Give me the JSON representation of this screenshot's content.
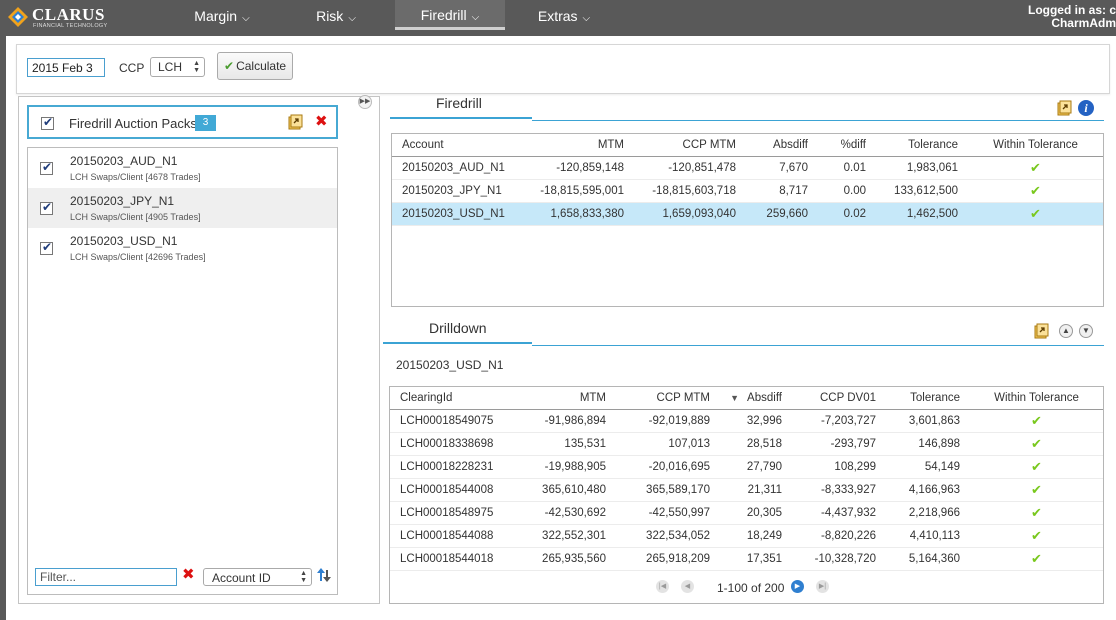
{
  "app": {
    "logo_name": "CLARUS",
    "logo_sub": "FINANCIAL TECHNOLOGY",
    "brand_colors": {
      "orange": "#f0a21c",
      "blue": "#2f7fd0"
    }
  },
  "nav": {
    "items": [
      {
        "label": "Margin",
        "active": false
      },
      {
        "label": "Risk",
        "active": false
      },
      {
        "label": "Firedrill",
        "active": true
      },
      {
        "label": "Extras",
        "active": false
      }
    ],
    "login_line1": "Logged in as: c",
    "login_line2": "CharmAdm"
  },
  "toolbar": {
    "date_value": "2015 Feb 3",
    "ccp_label": "CCP",
    "ccp_value": "LCH",
    "calculate_label": "Calculate"
  },
  "packs": {
    "title": "Firedrill Auction Packs",
    "count": "3",
    "items": [
      {
        "name": "20150203_AUD_N1",
        "desc": "LCH Swaps/Client [4678 Trades]"
      },
      {
        "name": "20150203_JPY_N1",
        "desc": "LCH Swaps/Client [4905 Trades]"
      },
      {
        "name": "20150203_USD_N1",
        "desc": "LCH Swaps/Client [42696 Trades]"
      }
    ],
    "filter_placeholder": "Filter...",
    "filter_field": "Account ID"
  },
  "firedrill": {
    "title": "Firedrill",
    "columns": [
      "Account",
      "MTM",
      "CCP MTM",
      "Absdiff",
      "%diff",
      "Tolerance",
      "Within Tolerance"
    ],
    "rows": [
      {
        "account": "20150203_AUD_N1",
        "mtm": "-120,859,148",
        "ccp_mtm": "-120,851,478",
        "absdiff": "7,670",
        "pctdiff": "0.01",
        "tolerance": "1,983,061",
        "within": "✔"
      },
      {
        "account": "20150203_JPY_N1",
        "mtm": "-18,815,595,001",
        "ccp_mtm": "-18,815,603,718",
        "absdiff": "8,717",
        "pctdiff": "0.00",
        "tolerance": "133,612,500",
        "within": "✔"
      },
      {
        "account": "20150203_USD_N1",
        "mtm": "1,658,833,380",
        "ccp_mtm": "1,659,093,040",
        "absdiff": "259,660",
        "pctdiff": "0.02",
        "tolerance": "1,462,500",
        "within": "✔"
      }
    ]
  },
  "drilldown": {
    "title": "Drilldown",
    "account": "20150203_USD_N1",
    "columns": [
      "ClearingId",
      "MTM",
      "CCP MTM",
      "Absdiff",
      "CCP DV01",
      "Tolerance",
      "Within Tolerance"
    ],
    "rows": [
      {
        "id": "LCH00018549075",
        "mtm": "-91,986,894",
        "ccp_mtm": "-92,019,889",
        "absdiff": "32,996",
        "dv01": "-7,203,727",
        "tolerance": "3,601,863",
        "within": "✔"
      },
      {
        "id": "LCH00018338698",
        "mtm": "135,531",
        "ccp_mtm": "107,013",
        "absdiff": "28,518",
        "dv01": "-293,797",
        "tolerance": "146,898",
        "within": "✔"
      },
      {
        "id": "LCH00018228231",
        "mtm": "-19,988,905",
        "ccp_mtm": "-20,016,695",
        "absdiff": "27,790",
        "dv01": "108,299",
        "tolerance": "54,149",
        "within": "✔"
      },
      {
        "id": "LCH00018544008",
        "mtm": "365,610,480",
        "ccp_mtm": "365,589,170",
        "absdiff": "21,311",
        "dv01": "-8,333,927",
        "tolerance": "4,166,963",
        "within": "✔"
      },
      {
        "id": "LCH00018548975",
        "mtm": "-42,530,692",
        "ccp_mtm": "-42,550,997",
        "absdiff": "20,305",
        "dv01": "-4,437,932",
        "tolerance": "2,218,966",
        "within": "✔"
      },
      {
        "id": "LCH00018544088",
        "mtm": "322,552,301",
        "ccp_mtm": "322,534,052",
        "absdiff": "18,249",
        "dv01": "-8,820,226",
        "tolerance": "4,410,113",
        "within": "✔"
      },
      {
        "id": "LCH00018544018",
        "mtm": "265,935,560",
        "ccp_mtm": "265,918,209",
        "absdiff": "17,351",
        "dv01": "-10,328,720",
        "tolerance": "5,164,360",
        "within": "✔"
      }
    ],
    "pager_text": "1-100 of 200"
  },
  "icons": {
    "export": "export-icon",
    "delete": "delete-x-icon",
    "info": "info-icon",
    "collapse": "collapse-left-icon",
    "sort": "sort-icon",
    "pager_first": "first-page-icon",
    "pager_prev": "prev-page-icon",
    "pager_next": "next-page-icon",
    "pager_last": "last-page-icon"
  }
}
